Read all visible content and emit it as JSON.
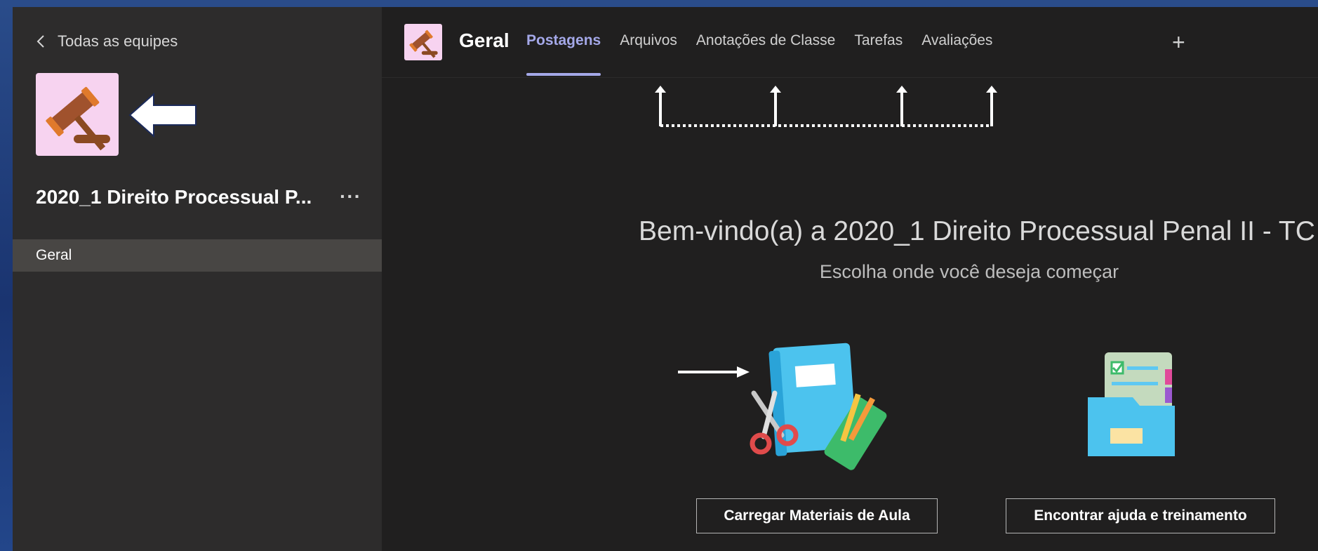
{
  "sidebar": {
    "back_label": "Todas as equipes",
    "team_name": "2020_1 Direito Processual P...",
    "more_label": "···",
    "channels": [
      {
        "label": "Geral",
        "selected": true
      }
    ]
  },
  "header": {
    "channel_title": "Geral",
    "tabs": [
      {
        "label": "Postagens",
        "active": true
      },
      {
        "label": "Arquivos",
        "active": false
      },
      {
        "label": "Anotações de Classe",
        "active": false
      },
      {
        "label": "Tarefas",
        "active": false
      },
      {
        "label": "Avaliações",
        "active": false
      }
    ],
    "add_tab_label": "+"
  },
  "main": {
    "welcome": "Bem-vindo(a) a 2020_1 Direito Processual Penal II - TC",
    "subtitle": "Escolha onde você deseja começar",
    "actions": [
      {
        "label": "Carregar Materiais de Aula"
      },
      {
        "label": "Encontrar ajuda e treinamento"
      }
    ]
  },
  "colors": {
    "accent": "#a4a8e8",
    "sidebar_bg": "#2d2c2c",
    "main_bg": "#201f1f",
    "selected_channel_bg": "#484644",
    "logo_bg": "#f7d3f0"
  },
  "icons": {
    "back": "chevron-left-icon",
    "logo": "gavel-icon",
    "more": "more-dots-icon",
    "add": "plus-icon"
  }
}
